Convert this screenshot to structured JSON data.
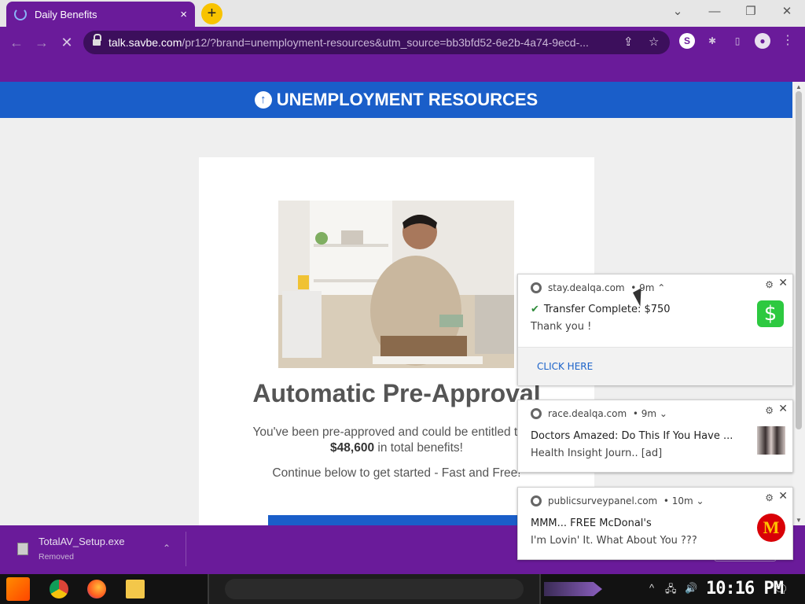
{
  "browser": {
    "tab_title": "Daily Benefits",
    "tab_close": "×",
    "new_tab": "+",
    "window_controls": {
      "dropdown": "⌄",
      "minimize": "—",
      "restore": "❐",
      "close": "✕"
    },
    "nav": {
      "back": "←",
      "forward": "→",
      "stop": "✕"
    },
    "url_host": "talk.savbe.com",
    "url_rest": "/pr12/?brand=unemployment-resources&utm_source=bb3bfd52-6e2b-4a74-9ecd-...",
    "omnibox_icons": {
      "share": "⇪",
      "bookmark": "☆"
    },
    "toolbar_icons": {
      "extension_s": "S",
      "puzzle": "✱",
      "sidepanel": "▯",
      "profile": "●",
      "menu": "⋮"
    }
  },
  "page": {
    "banner_icon": "↑",
    "banner_text": "UNEMPLOYMENT RESOURCES",
    "headline": "Automatic Pre-Approval",
    "subtext_before": "You've been pre-approved and could be entitled to as",
    "amount": "$48,600",
    "subtext_after": " in total benefits!",
    "continue_text": "Continue below to get started - Fast and Free!"
  },
  "download_shelf": {
    "file_name": "TotalAV_Setup.exe",
    "status": "Removed",
    "chevron": "⌃"
  },
  "notifications": [
    {
      "source": "stay.dealqa.com",
      "age": "• 9m ⌃",
      "title": "Transfer Complete: $750",
      "check": "✔",
      "body": "Thank you !",
      "app_icon": "$",
      "action": "CLICK HERE"
    },
    {
      "source": "race.dealqa.com",
      "age": "• 9m ⌄",
      "title": "Doctors Amazed: Do This If You Have ...",
      "body": "Health Insight Journ.. [ad]"
    },
    {
      "source": "publicsurveypanel.com",
      "age": "• 10m ⌄",
      "title": "MMM... FREE McDonal's",
      "body": "I'm Lovin' It. What About You  ???",
      "app_icon": "M"
    }
  ],
  "notification_controls": {
    "gear": "⚙",
    "close": "✕"
  },
  "taskbar": {
    "tray_chevron": "^",
    "tray_network": "🖧",
    "tray_volume": "🔊",
    "clock": "10:16 PM",
    "action_center": "🗨"
  },
  "colors": {
    "theme_purple": "#6a1b9a",
    "banner_blue": "#1a5ec9",
    "cash_green": "#2dc940",
    "mcd_red": "#d90007"
  }
}
